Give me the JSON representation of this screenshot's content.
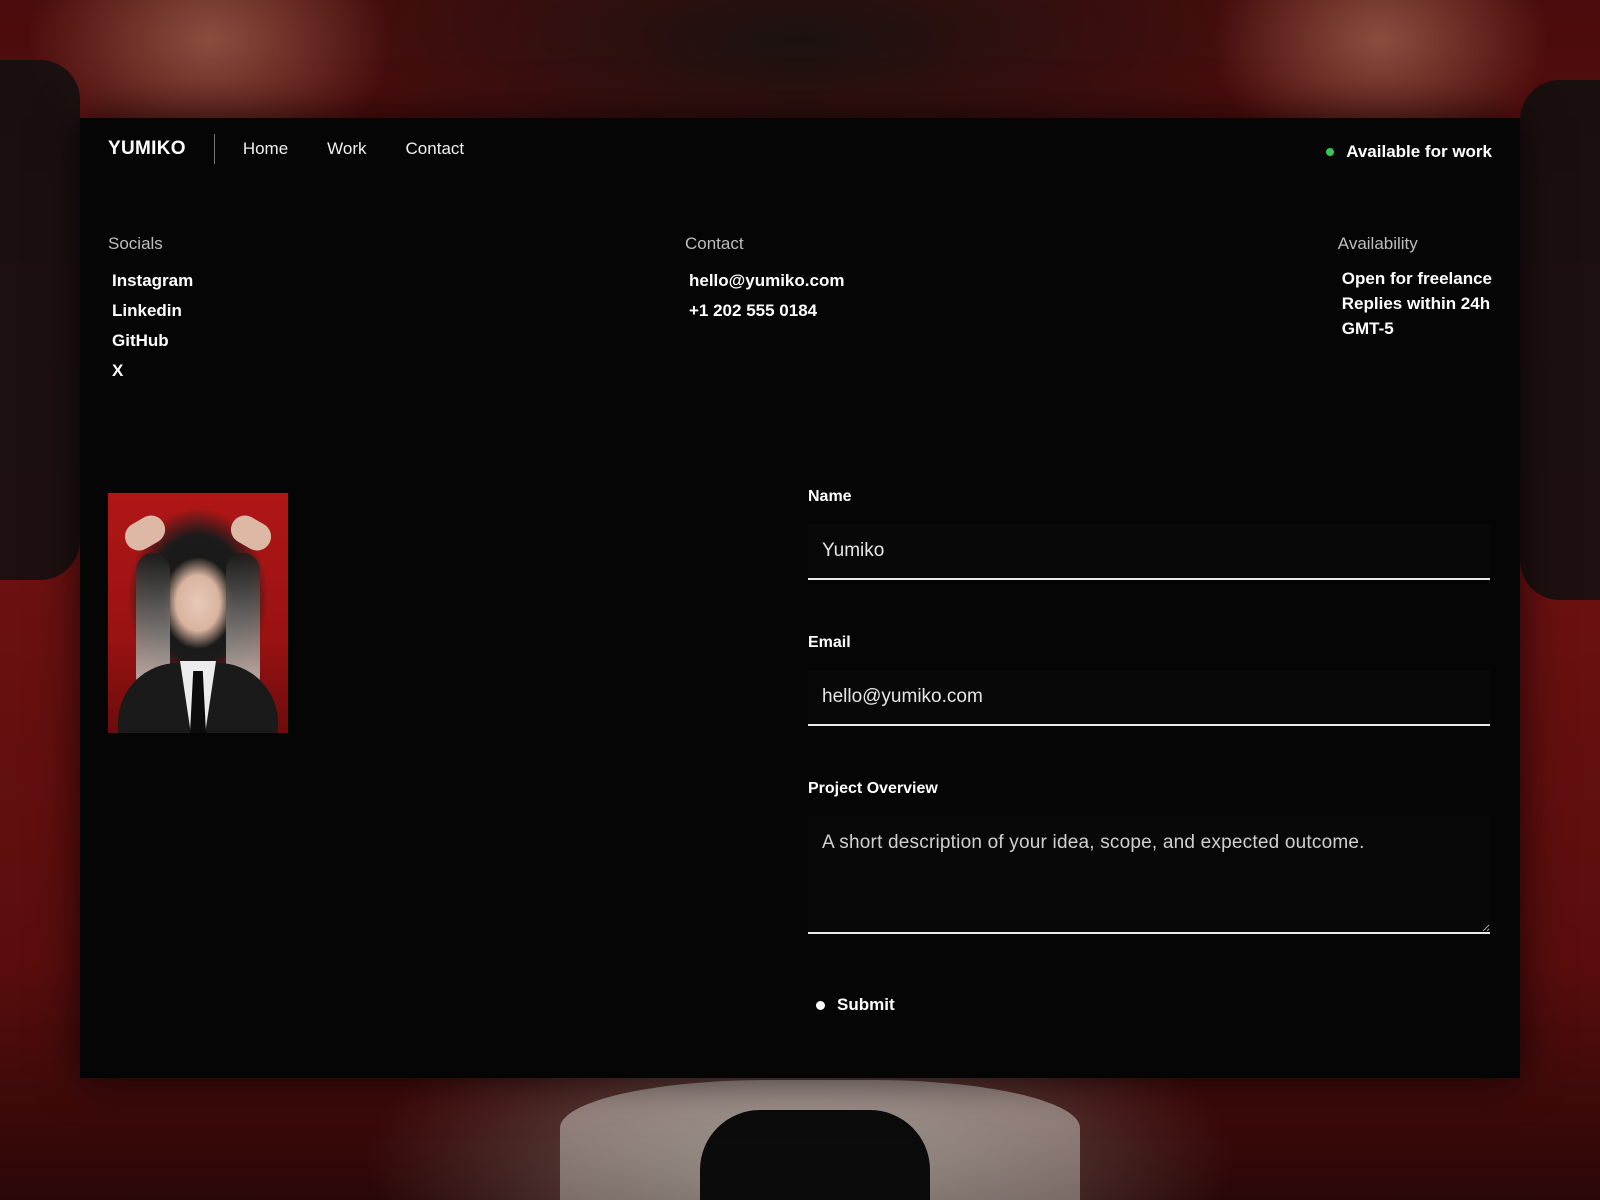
{
  "brand": {
    "logo": "YUMIKO"
  },
  "nav": {
    "links": [
      {
        "label": "Home"
      },
      {
        "label": "Work"
      },
      {
        "label": "Contact"
      }
    ],
    "status": {
      "label": "Available for work",
      "dot_color": "#35c759"
    }
  },
  "info": {
    "socials": {
      "title": "Socials",
      "items": [
        "Instagram",
        "Linkedin",
        "GitHub",
        "X"
      ]
    },
    "contact": {
      "title": "Contact",
      "items": [
        "hello@yumiko.com",
        "+1 202 555 0184"
      ]
    },
    "availability": {
      "title": "Availability",
      "items": [
        "Open for freelance",
        "Replies within 24h",
        "GMT-5"
      ]
    }
  },
  "form": {
    "name": {
      "label": "Name",
      "value": "Yumiko"
    },
    "email": {
      "label": "Email",
      "value": "hello@yumiko.com"
    },
    "overview": {
      "label": "Project Overview",
      "placeholder": "A short description of your idea, scope, and expected outcome."
    },
    "submit_label": "Submit"
  },
  "colors": {
    "background_red": "#6e1111",
    "panel": "#050505",
    "accent_green": "#35c759"
  }
}
